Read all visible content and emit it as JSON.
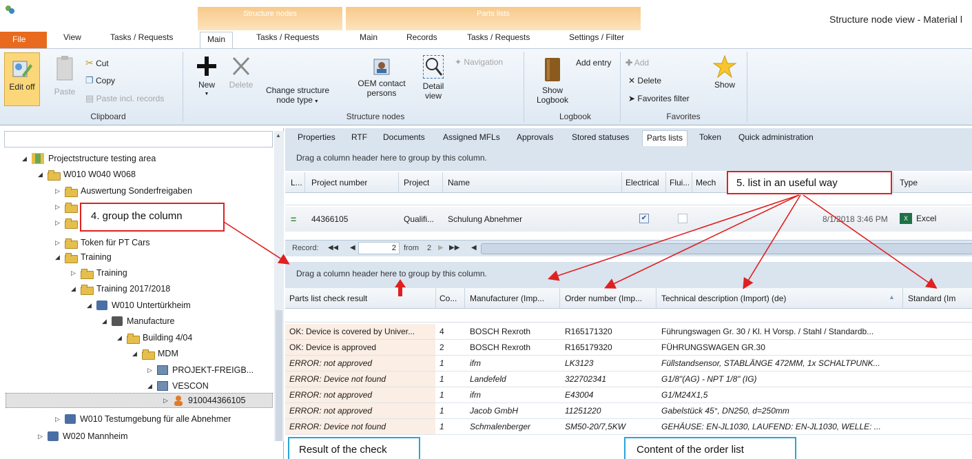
{
  "window": {
    "title": "Structure node view - Material l",
    "context_tabs": [
      "Structure nodes",
      "Parts lists"
    ],
    "tabs": [
      "File",
      "View",
      "Tasks / Requests",
      "Main",
      "Tasks / Requests",
      "Main",
      "Records",
      "Tasks / Requests",
      "Settings / Filter"
    ]
  },
  "ribbon": {
    "edit_off": "Edit off",
    "paste": "Paste",
    "cut": "Cut",
    "copy": "Copy",
    "paste_incl_records": "Paste incl. records",
    "clipboard": "Clipboard",
    "new": "New",
    "delete": "Delete",
    "change_structure_node_type_1": "Change structure",
    "change_structure_node_type_2": "node type",
    "oem_contact_persons_1": "OEM contact",
    "oem_contact_persons_2": "persons",
    "detail_view_1": "Detail",
    "detail_view_2": "view",
    "navigation": "Navigation",
    "structure_nodes": "Structure nodes",
    "show_logbook_1": "Show",
    "show_logbook_2": "Logbook",
    "add_entry": "Add entry",
    "logbook": "Logbook",
    "add": "Add",
    "fav_delete": "Delete",
    "favorites_filter": "Favorites filter",
    "show": "Show",
    "favorites": "Favorites"
  },
  "tree": {
    "items": [
      {
        "label": "Projectstructure testing area"
      },
      {
        "label": "W010 W040 W068"
      },
      {
        "label": "Auswertung Sonderfreigaben"
      },
      {
        "label": ""
      },
      {
        "label": ""
      },
      {
        "label": "Token für PT Cars"
      },
      {
        "label": "Training"
      },
      {
        "label": "Training"
      },
      {
        "label": "Training 2017/2018"
      },
      {
        "label": "W010 Untertürkheim"
      },
      {
        "label": "Manufacture"
      },
      {
        "label": "Building 4/04"
      },
      {
        "label": "MDM"
      },
      {
        "label": "PROJEKT-FREIGB..."
      },
      {
        "label": "VESCON"
      },
      {
        "label": "910044366105"
      },
      {
        "label": "W010 Testumgebung für alle Abnehmer"
      },
      {
        "label": "W020 Mannheim"
      }
    ]
  },
  "detail_tabs": [
    "Properties",
    "RTF",
    "Documents",
    "Assigned MFLs",
    "Approvals",
    "Stored statuses",
    "Parts lists",
    "Token",
    "Quick administration"
  ],
  "group_hint": "Drag a column header here to group by this column.",
  "top_grid": {
    "columns": [
      "L...",
      "Project number",
      "Project",
      "Name",
      "Electrical",
      "Flui...",
      "Mech",
      "Type"
    ],
    "row": {
      "status": "=",
      "project_number": "44366105",
      "project": "Qualifi...",
      "name": "Schulung Abnehmer",
      "electrical_checked": true,
      "date": "8/1/2018 3:46 PM",
      "type": "Excel"
    },
    "record_label": "Record:",
    "record_value": "2",
    "record_from": "from",
    "record_total": "2"
  },
  "bottom_grid": {
    "columns": [
      "Parts list check result",
      "Co...",
      "Manufacturer (Imp...",
      "Order number (Imp...",
      "Technical description (Import) (de)",
      "Standard (Im"
    ],
    "rows": [
      {
        "result": "OK: Device is covered by Univer...",
        "count": "4",
        "manufacturer": "BOSCH Rexroth",
        "order": "R165171320",
        "desc": "Führungswagen Gr. 30 / Kl.  H Vorsp. / Stahl / Standardb...",
        "italic": false
      },
      {
        "result": "OK: Device is approved",
        "count": "2",
        "manufacturer": "BOSCH Rexroth",
        "order": "R165179320",
        "desc": "FÜHRUNGSWAGEN GR.30",
        "italic": false
      },
      {
        "result": "ERROR: not approved",
        "count": "1",
        "manufacturer": "ifm",
        "order": "LK3123",
        "desc": "Füllstandsensor, STABLÄNGE 472MM, 1x SCHALTPUNK...",
        "italic": true
      },
      {
        "result": "ERROR: Device not found",
        "count": "1",
        "manufacturer": "Landefeld",
        "order": "322702341",
        "desc": "G1/8\"(AG) - NPT 1/8\" (IG)",
        "italic": true
      },
      {
        "result": "ERROR: not approved",
        "count": "1",
        "manufacturer": "ifm",
        "order": "E43004",
        "desc": "G1/M24X1,5",
        "italic": true
      },
      {
        "result": "ERROR: not approved",
        "count": "1",
        "manufacturer": "Jacob GmbH",
        "order": "11251220",
        "desc": "Gabelstück 45°, DN250, d=250mm",
        "italic": true
      },
      {
        "result": "ERROR: Device not found",
        "count": "1",
        "manufacturer": "Schmalenberger",
        "order": "SM50-20/7,5KW",
        "desc": "GEHÄUSE: EN-JL1030, LAUFEND: EN-JL1030, WELLE: ...",
        "italic": true
      }
    ]
  },
  "callouts": {
    "group_column": "4. group the column",
    "list_useful": "5. list in an useful way",
    "result_check": "Result of the check",
    "content_order": "Content of the order list"
  },
  "colors": {
    "annotation_red": "#e02020",
    "callout_blue": "#2aa4d6",
    "file_tab": "#e86a1e",
    "context_tab": "#f8c98a"
  }
}
